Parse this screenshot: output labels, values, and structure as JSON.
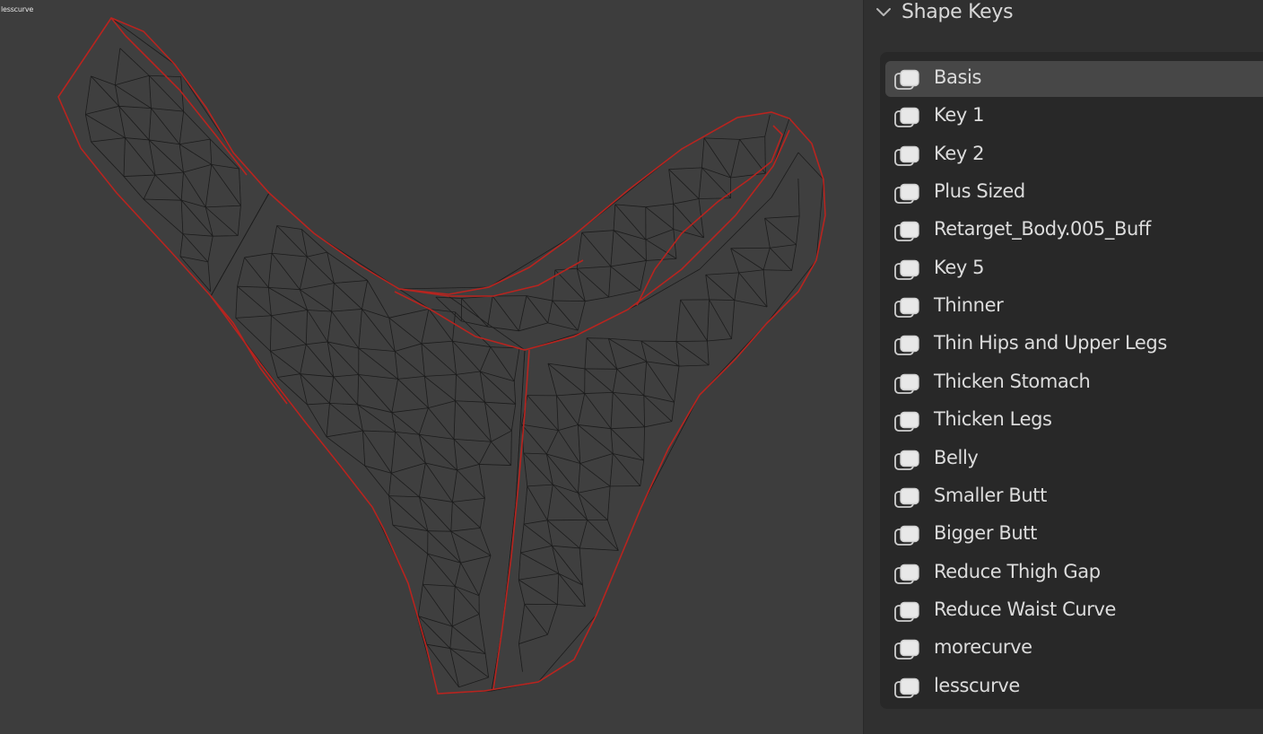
{
  "viewport": {
    "object_label": "lesscurve",
    "wire_color": "#1c1c1c",
    "seam_color": "#b8241f"
  },
  "panel": {
    "title": "Shape Keys",
    "chevron_icon": "chevron-down-icon",
    "shape_key_icon": "shape-key-icon",
    "selected_index": 0,
    "shape_keys": [
      {
        "label": "Basis"
      },
      {
        "label": "Key 1"
      },
      {
        "label": "Key 2"
      },
      {
        "label": "Plus Sized"
      },
      {
        "label": "Retarget_Body.005_Buff"
      },
      {
        "label": "Key 5"
      },
      {
        "label": "Thinner"
      },
      {
        "label": "Thin Hips and Upper Legs"
      },
      {
        "label": "Thicken Stomach"
      },
      {
        "label": "Thicken Legs"
      },
      {
        "label": "Belly"
      },
      {
        "label": "Smaller Butt"
      },
      {
        "label": "Bigger Butt"
      },
      {
        "label": "Reduce Thigh Gap"
      },
      {
        "label": "Reduce Waist Curve"
      },
      {
        "label": "morecurve"
      },
      {
        "label": "lesscurve"
      }
    ]
  }
}
